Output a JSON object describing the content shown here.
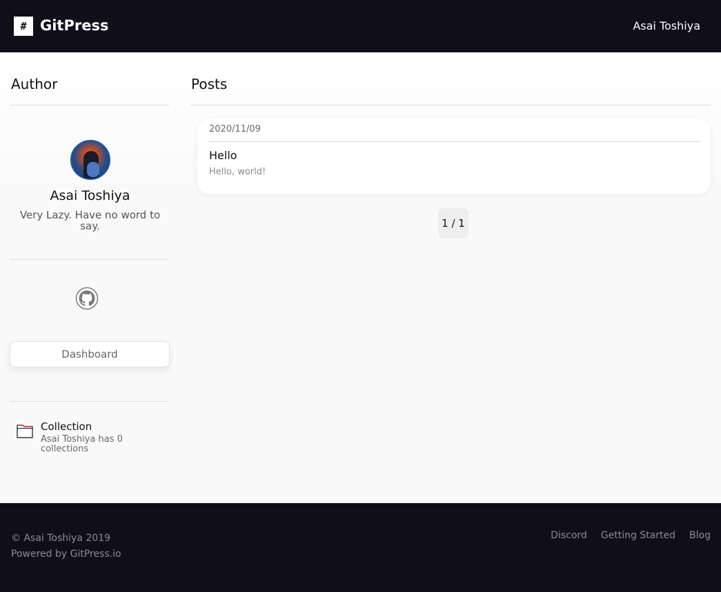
{
  "header": {
    "logo_symbol": "#",
    "brand": "GitPress",
    "user_name": "Asai Toshiya"
  },
  "author": {
    "section_title": "Author",
    "name": "Asai Toshiya",
    "bio": "Very Lazy. Have no word to say.",
    "dashboard_label": "Dashboard",
    "collection_title": "Collection",
    "collection_desc": "Asai Toshiya has 0 collections"
  },
  "posts": {
    "section_title": "Posts",
    "items": [
      {
        "date": "2020/11/09",
        "title": "Hello",
        "excerpt": "Hello, world!"
      }
    ],
    "pagination": "1 / 1"
  },
  "footer": {
    "copyright": "© Asai Toshiya 2019",
    "powered_by": "Powered by GitPress.io",
    "links": [
      "Discord",
      "Getting Started",
      "Blog"
    ]
  },
  "colors": {
    "header_bg": "#100f19",
    "page_bg": "#f9f9f9"
  },
  "icons": {
    "logo": "hash-logo-icon",
    "github": "github-icon",
    "folder": "folder-icon",
    "avatar": "avatar-photo"
  }
}
